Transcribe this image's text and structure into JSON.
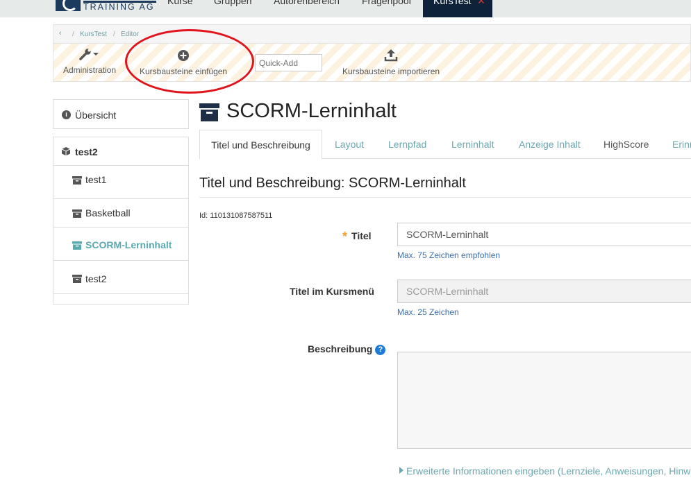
{
  "topnav": {
    "logo_text": "TRAINING AG",
    "items": [
      {
        "label": "Kurse"
      },
      {
        "label": "Gruppen"
      },
      {
        "label": "Autorenbereich"
      },
      {
        "label": "Fragenpool"
      }
    ],
    "active_tab": {
      "label": "KursTest",
      "close": "✕"
    }
  },
  "breadcrumb": {
    "back": "‹",
    "sep": "/",
    "items": [
      "KursTest",
      "Editor"
    ]
  },
  "toolbar": {
    "admin_label": "Administration",
    "insert_label": "Kursbausteine einfügen",
    "quickadd_placeholder": "Quick-Add",
    "import_label": "Kursbausteine importieren"
  },
  "sidebar": {
    "overview_label": "Übersicht",
    "overview_icon": "i",
    "tree": {
      "root": "test2",
      "children": [
        {
          "label": "test1"
        },
        {
          "label": "Basketball"
        },
        {
          "label": "SCORM-Lerninhalt"
        },
        {
          "label": "test2"
        }
      ]
    }
  },
  "main": {
    "title": "SCORM-Lerninhalt",
    "tabs": [
      {
        "label": "Titel und Beschreibung"
      },
      {
        "label": "Layout"
      },
      {
        "label": "Lernpfad"
      },
      {
        "label": "Lerninhalt"
      },
      {
        "label": "Anzeige Inhalt"
      },
      {
        "label": "HighScore"
      },
      {
        "label": "Erinn"
      }
    ],
    "section_title": "Titel und Beschreibung: SCORM-Lerninhalt",
    "id_line": "Id: 110131087587511",
    "form": {
      "title_required": "*",
      "title_label": "Titel",
      "title_value": "SCORM-Lerninhalt",
      "title_hint": "Max. 75 Zeichen empfohlen",
      "menu_label": "Titel im Kursmenü",
      "menu_value": "SCORM-Lerninhalt",
      "menu_hint": "Max. 25 Zeichen",
      "description_label": "Beschreibung",
      "help_icon": "?"
    },
    "extended_link": "Erweiterte Informationen eingeben (Lernziele, Anweisungen, Hinw"
  },
  "colors": {
    "nav_bg": "#e6ebea",
    "active_tab_bg": "#0e2239",
    "link_teal": "#6aa9b0",
    "hint_blue": "#3b6fae",
    "annotation_red": "#e2141b",
    "required_orange": "#f0a030"
  }
}
